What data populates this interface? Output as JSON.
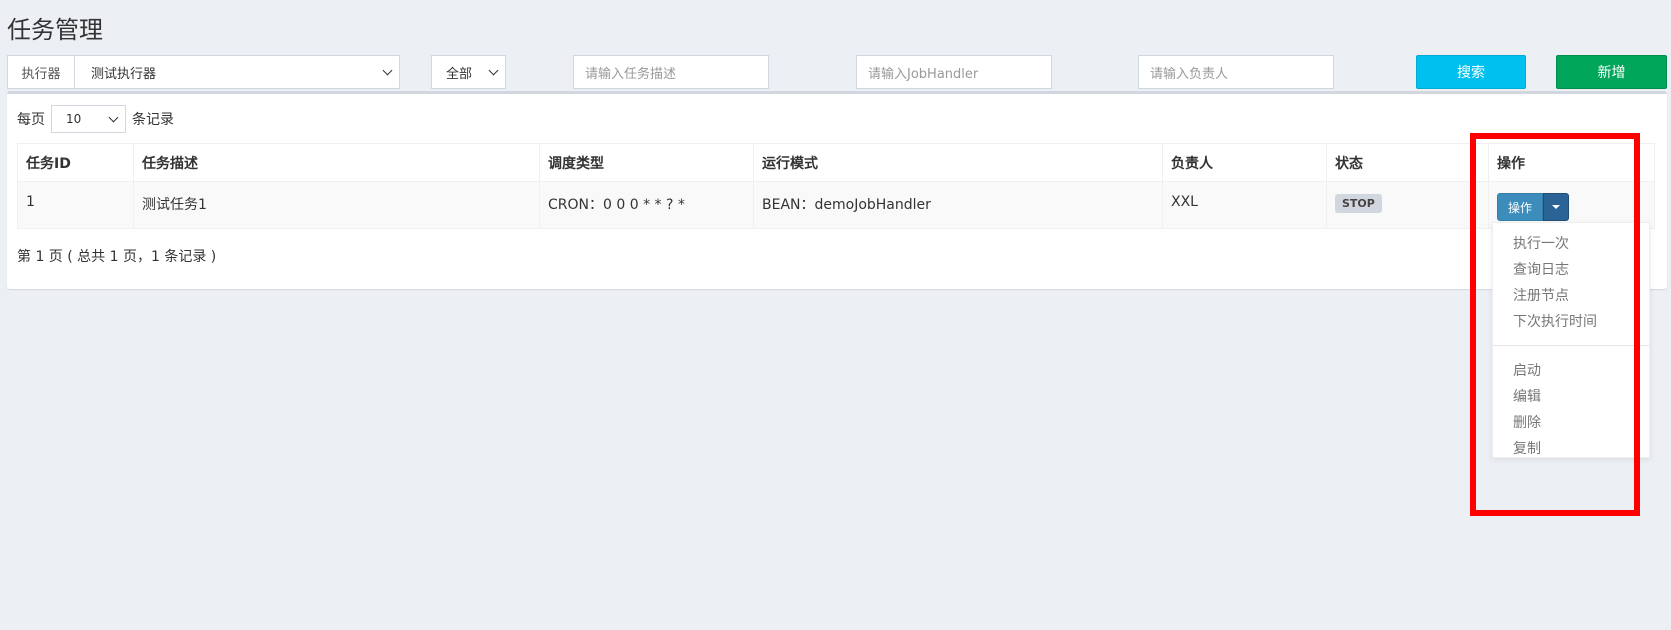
{
  "page": {
    "title": "任务管理"
  },
  "filters": {
    "executor_label": "执行器",
    "executor_value": "测试执行器",
    "status_value": "全部",
    "desc_placeholder": "请输入任务描述",
    "handler_placeholder": "请输入JobHandler",
    "author_placeholder": "请输入负责人",
    "search_label": "搜索",
    "add_label": "新增"
  },
  "length": {
    "prefix": "每页",
    "value": "10",
    "suffix": "条记录"
  },
  "table": {
    "headers": [
      "任务ID",
      "任务描述",
      "调度类型",
      "运行模式",
      "负责人",
      "状态",
      "操作"
    ],
    "rows": [
      {
        "id": "1",
        "desc": "测试任务1",
        "schedule": "CRON：0 0 0 * * ? *",
        "mode": "BEAN：demoJobHandler",
        "author": "XXL",
        "status": "STOP",
        "action": "操作"
      }
    ]
  },
  "pager": {
    "info": "第 1 页 ( 总共 1 页，1 条记录 )"
  },
  "menu": {
    "group1": [
      "执行一次",
      "查询日志",
      "注册节点",
      "下次执行时间"
    ],
    "group2": [
      "启动",
      "编辑",
      "删除",
      "复制"
    ]
  },
  "colors": {
    "highlight": "#ff0000",
    "search": "#00c0ef",
    "add": "#00a65a",
    "primary": "#3c8dbc"
  }
}
